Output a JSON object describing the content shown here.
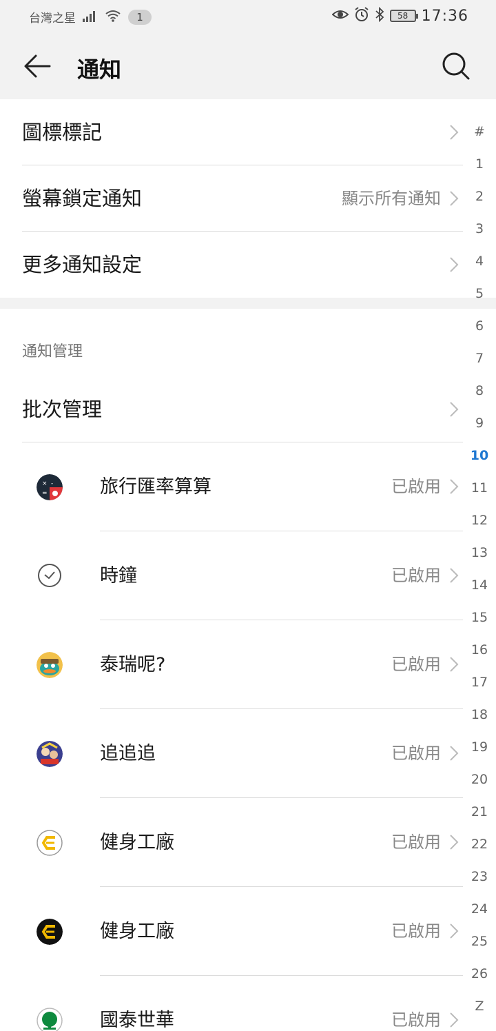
{
  "status_bar": {
    "carrier": "台灣之星",
    "badge": "1",
    "battery": "58",
    "time": "17:36"
  },
  "header": {
    "title": "通知",
    "back_icon": "arrow-left-icon",
    "search_icon": "search-icon"
  },
  "settings": [
    {
      "label": "圖標標記",
      "value": ""
    },
    {
      "label": "螢幕鎖定通知",
      "value": "顯示所有通知"
    },
    {
      "label": "更多通知設定",
      "value": ""
    }
  ],
  "management": {
    "header": "通知管理",
    "batch_label": "批次管理",
    "apps": [
      {
        "name": "旅行匯率算算",
        "status": "已啟用",
        "icon": "currency-calculator-icon"
      },
      {
        "name": "時鐘",
        "status": "已啟用",
        "icon": "clock-icon"
      },
      {
        "name": "泰瑞呢?",
        "status": "已啟用",
        "icon": "platypus-game-icon"
      },
      {
        "name": "追追追",
        "status": "已啟用",
        "icon": "chase-game-icon"
      },
      {
        "name": "健身工廠",
        "status": "已啟用",
        "icon": "fitness-factory-icon"
      },
      {
        "name": "健身工廠",
        "status": "已啟用",
        "icon": "fitness-factory-dark-icon"
      },
      {
        "name": "國泰世華",
        "status": "已啟用",
        "icon": "cathay-bank-icon"
      }
    ]
  },
  "index": {
    "items": [
      "#",
      "1",
      "2",
      "3",
      "4",
      "5",
      "6",
      "7",
      "8",
      "9",
      "10",
      "11",
      "12",
      "13",
      "14",
      "15",
      "16",
      "17",
      "18",
      "19",
      "20",
      "21",
      "22",
      "23",
      "24",
      "25",
      "26",
      "Z"
    ],
    "active": "10"
  },
  "colors": {
    "accent": "#1f78d1",
    "background": "#f2f2f2",
    "secondary_text": "#888888"
  }
}
